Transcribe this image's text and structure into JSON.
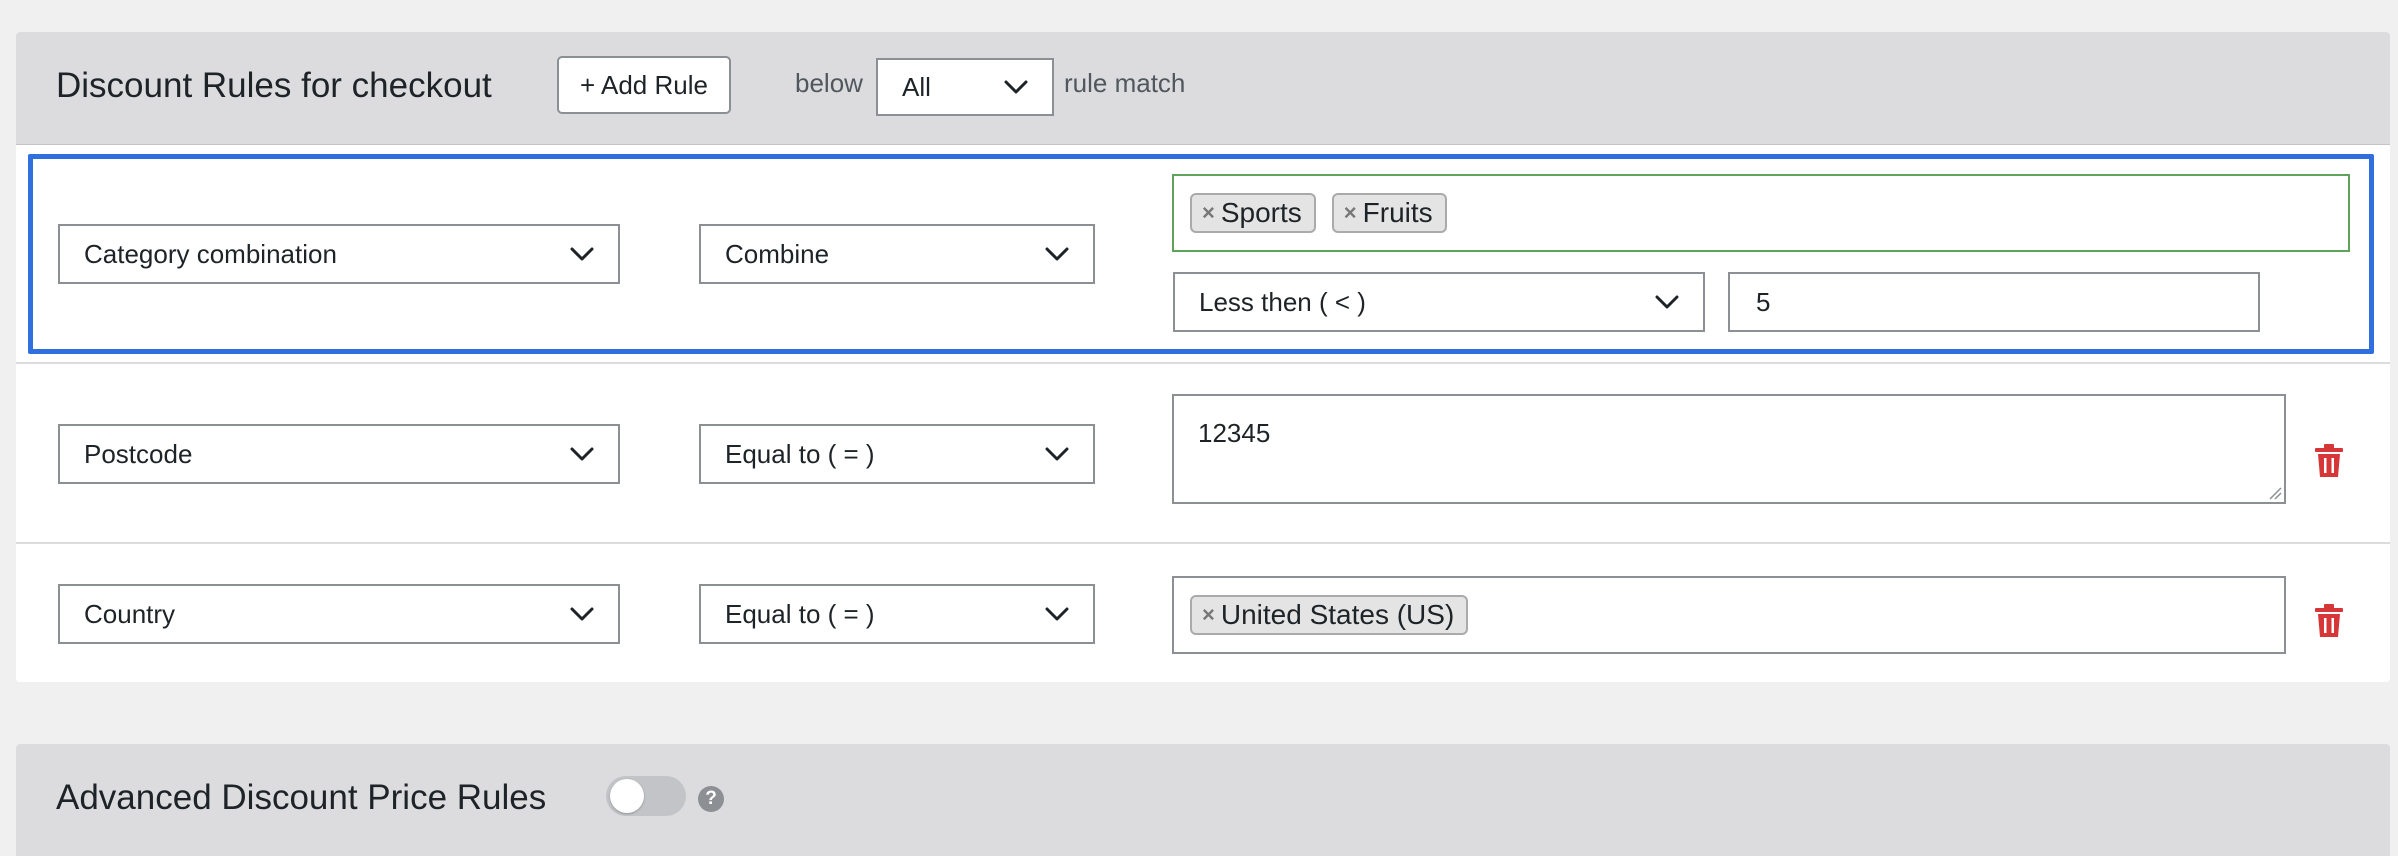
{
  "panel": {
    "title": "Discount Rules for checkout",
    "add_rule_label": "+ Add Rule",
    "below_label": "below",
    "match_select": "All",
    "rule_match_label": "rule match"
  },
  "rules": [
    {
      "field": "Category combination",
      "operator": "Combine",
      "tags": [
        "Sports",
        "Fruits"
      ],
      "sub_operator": "Less then ( < )",
      "sub_value": "5"
    },
    {
      "field": "Postcode",
      "operator": "Equal to ( = )",
      "value": "12345"
    },
    {
      "field": "Country",
      "operator": "Equal to ( = )",
      "tags": [
        "United States (US)"
      ]
    }
  ],
  "advanced": {
    "title": "Advanced Discount Price Rules",
    "toggle_on": false,
    "help_glyph": "?"
  },
  "colors": {
    "highlight_border": "#2f6fde",
    "tag_box_valid": "#5fa35a",
    "delete_icon": "#d63638"
  },
  "icons": [
    "chevron-down-icon",
    "tag-remove-icon",
    "trash-icon",
    "help-icon"
  ]
}
